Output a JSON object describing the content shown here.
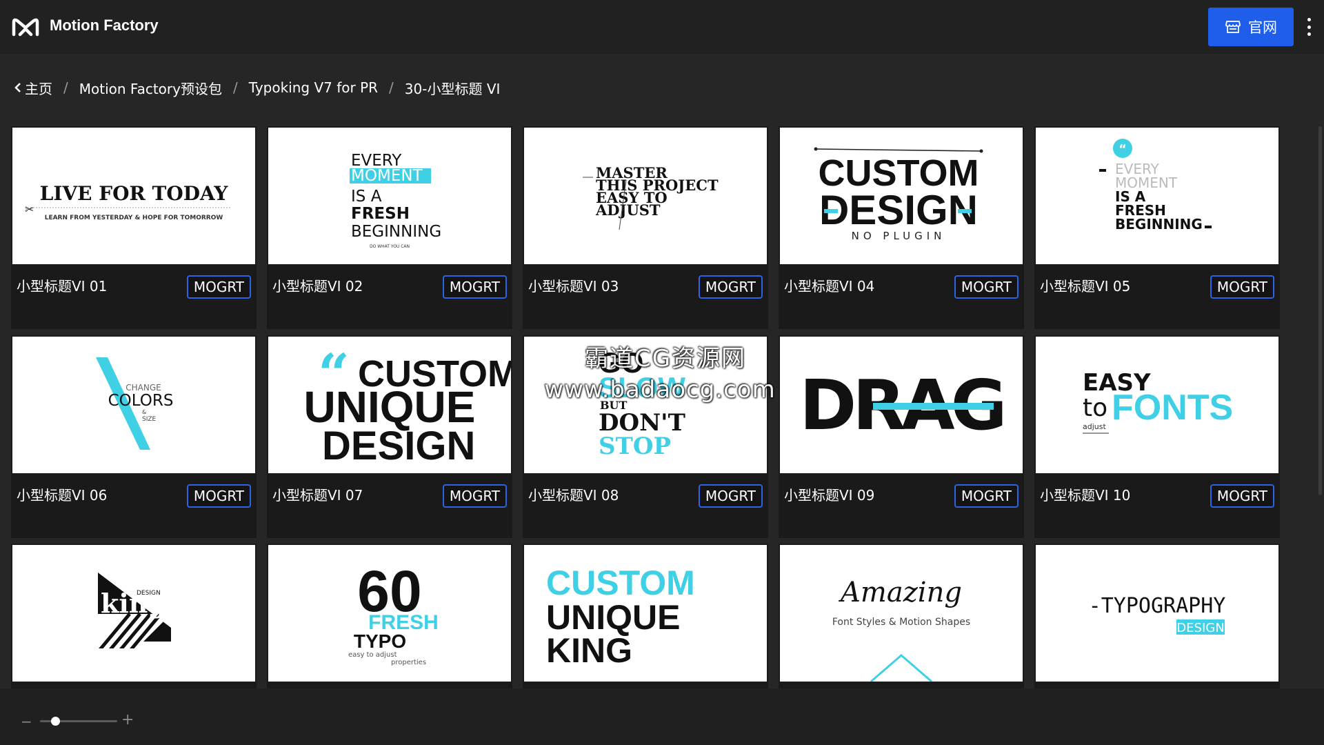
{
  "header": {
    "app_name": "Motion Factory",
    "site_button_label": "官网",
    "accent_color": "#1f5eea"
  },
  "breadcrumb": {
    "items": [
      "主页",
      "Motion Factory预设包",
      "Typoking V7 for PR",
      "30-小型标题 VI"
    ],
    "separator": "/"
  },
  "cards": [
    {
      "label": "小型标题VI 01",
      "badge": "MOGRT",
      "thumb_title": "LIVE FOR TODAY",
      "thumb_sub": "LEARN FROM YESTERDAY & HOPE FOR TOMORROW"
    },
    {
      "label": "小型标题VI 02",
      "badge": "MOGRT",
      "thumb_lines": [
        "EVERY",
        "MOMENT",
        "IS A",
        "FRESH",
        "BEGINNING"
      ],
      "thumb_sub": "DO WHAT YOU CAN"
    },
    {
      "label": "小型标题VI 03",
      "badge": "MOGRT",
      "thumb_lines": [
        "MASTER",
        "THIS PROJECT",
        "EASY TO",
        "ADJUST"
      ]
    },
    {
      "label": "小型标题VI 04",
      "badge": "MOGRT",
      "thumb_lines": [
        "CUSTOM",
        "DESIGN",
        "NO PLUGIN"
      ]
    },
    {
      "label": "小型标题VI 05",
      "badge": "MOGRT",
      "thumb_lines": [
        "EVERY",
        "MOMENT",
        "IS A",
        "FRESH",
        "BEGINNING"
      ]
    },
    {
      "label": "小型标题VI 06",
      "badge": "MOGRT",
      "thumb_lines": [
        "CHANGE",
        "COLORS",
        "&",
        "SIZE"
      ]
    },
    {
      "label": "小型标题VI 07",
      "badge": "MOGRT",
      "thumb_lines": [
        "CUSTOM",
        "UNIQUE",
        "DESIGN"
      ]
    },
    {
      "label": "小型标题VI 08",
      "badge": "MOGRT",
      "thumb_lines": [
        "GO",
        "SLOW",
        "BUT",
        "DON'T",
        "STOP"
      ]
    },
    {
      "label": "小型标题VI 09",
      "badge": "MOGRT",
      "thumb_lines": [
        "DRAG"
      ]
    },
    {
      "label": "小型标题VI 10",
      "badge": "MOGRT",
      "thumb_lines": [
        "EASY",
        "to",
        "FONTS",
        "adjust"
      ]
    },
    {
      "thumb_lines": [
        "DESIGN",
        "king"
      ]
    },
    {
      "thumb_lines": [
        "60",
        "FRESH",
        "TYPO",
        "easy to adjust",
        "properties"
      ]
    },
    {
      "thumb_lines": [
        "CUSTOM",
        "UNIQUE",
        "KING"
      ]
    },
    {
      "thumb_lines": [
        "Amazing",
        "Font Styles & Motion Shapes"
      ]
    },
    {
      "thumb_lines": [
        "-TYPOGRAPHY",
        "DESIGN"
      ]
    }
  ],
  "watermark": {
    "line1": "霸道CG资源网",
    "line2": "www.badaocg.com"
  },
  "zoom": {
    "minus": "−",
    "plus": "+",
    "level": 0.2
  },
  "colors": {
    "cyan": "#3fd0e6",
    "badge_border": "#2d63e6"
  }
}
